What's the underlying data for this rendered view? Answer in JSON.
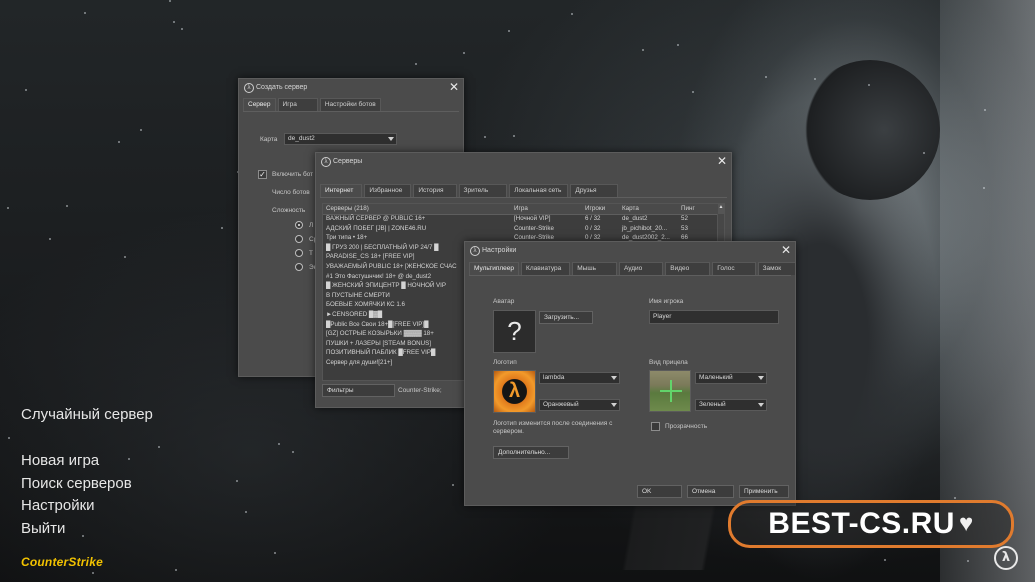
{
  "main_menu": {
    "random_server": "Случайный сервер",
    "new_game": "Новая игра",
    "find_servers": "Поиск серверов",
    "settings": "Настройки",
    "quit": "Выйти"
  },
  "logo_text": "CounterStrike",
  "watermark": "BEST-CS.RU",
  "create_server": {
    "title": "Создать сервер",
    "tabs": [
      "Сервер",
      "Игра",
      "Настройки ботов"
    ],
    "map_label": "Карта",
    "map_value": "de_dust2",
    "enable_bots": "Включить бот",
    "bot_count": "Число ботов",
    "difficulty": "Сложность",
    "radio_fragments": [
      "Л",
      "Ср",
      "Т",
      "Эк"
    ]
  },
  "servers": {
    "title": "Серверы",
    "tabs": [
      "Интернет",
      "Избранное",
      "История",
      "Зритель",
      "Локальная сеть",
      "Друзья"
    ],
    "columns": [
      "Серверы (218)",
      "Игра",
      "Игроки",
      "Карта",
      "Пинг"
    ],
    "rows": [
      [
        "ВАЖНЫЙ СЕРВЕР @ PUBLIC 16+",
        "[Ночной VIP]",
        "6 / 32",
        "de_dust2",
        "52"
      ],
      [
        "АДСКИЙ ПОБЕГ [JB] | ZONE46.RU",
        "Counter-Strike",
        "0 / 32",
        "jb_pichibot_20...",
        "53"
      ],
      [
        "Три типа • 18+",
        "Counter-Strike",
        "0 / 32",
        "de_dust2002_2...",
        "66"
      ],
      [
        "█ ГРУЗ 200 | БЕСПЛАТНЫЙ VIP 24/7 █",
        "",
        "",
        "",
        ""
      ],
      [
        "PARADISE_CS 18+ [FREE VIP]",
        "",
        "",
        "",
        ""
      ],
      [
        "УВАЖАЕМЫЙ PUBLIC 18+ [ЖЕНСКОЕ СЧАС",
        "",
        "",
        "",
        ""
      ],
      [
        "#1 Это Фастушнчик! 18+ @ de_dust2",
        "",
        "",
        "",
        ""
      ],
      [
        "█ ЖЕНСКИЙ ЭПИЦЕНТР █ НОЧНОЙ VIP",
        "",
        "",
        "",
        ""
      ],
      [
        "В ПУСТЫНЕ СМЕРТИ",
        "",
        "",
        "",
        ""
      ],
      [
        "БОЕВЫЕ ХОМЯЧКИ КС 1.6",
        "",
        "",
        "",
        ""
      ],
      [
        "►CENSORED █▓█",
        "",
        "",
        "",
        ""
      ],
      [
        "█Public Все Свои 18+█[FREE VIP]█",
        "",
        "",
        "",
        ""
      ],
      [
        "[GZ] ОСТРЫЕ КОЗЫРЬКИ ▓▓▓▓ 18+",
        "",
        "",
        "",
        ""
      ],
      [
        "ПУШКИ + ЛАЗЕРЫ [STEAM BONUS]",
        "",
        "",
        "",
        ""
      ],
      [
        "ПОЗИТИВНЫЙ ПАБЛИК █FREE VIP█",
        "",
        "",
        "",
        ""
      ],
      [
        "Сервер для души![21+]",
        "",
        "",
        "",
        ""
      ]
    ],
    "filters_button": "Фильтры",
    "filter_game": "Counter-Strike;"
  },
  "settings": {
    "title": "Настройки",
    "tabs": [
      "Мультиплеер",
      "Клавиатура",
      "Мышь",
      "Аудио",
      "Видео",
      "Голос",
      "Замок"
    ],
    "avatar_label": "Аватар",
    "avatar_placeholder": "?",
    "upload_button": "Загрузить...",
    "player_name_label": "Имя игрока",
    "player_name_value": "Player",
    "logo_label": "Логотип",
    "logo_select": "lambda",
    "color_select": "Оранжевый",
    "crosshair_label": "Вид прицела",
    "crosshair_size": "Маленький",
    "crosshair_color": "Зеленый",
    "transparency": "Прозрачность",
    "logo_note": "Логотип изменится после соединения с сервером.",
    "advanced_button": "Дополнительно...",
    "ok_button": "OK",
    "cancel_button": "Отмена",
    "apply_button": "Применить"
  },
  "colors": {
    "accent_orange": "#e07b2e",
    "logo_yellow": "#f2c200",
    "window_bg": "#4b4b4b"
  }
}
